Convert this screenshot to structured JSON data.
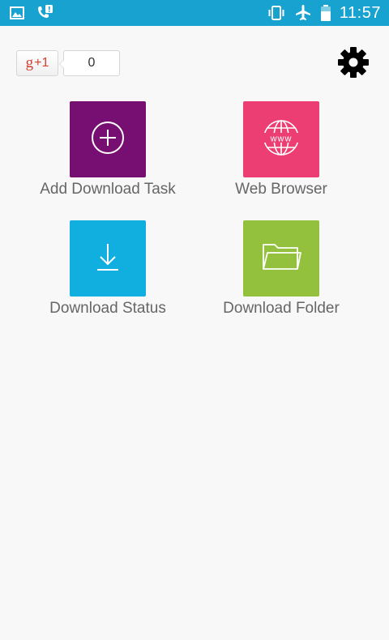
{
  "status_bar": {
    "time": "11:57",
    "color": "#17a2cf",
    "icons_left": [
      "image-icon",
      "phone-alert-icon"
    ],
    "icons_right": [
      "vibrate-icon",
      "airplane-icon",
      "battery-icon"
    ]
  },
  "gplus": {
    "g_label": "g",
    "plus_label": "+1",
    "count": "0"
  },
  "settings": {
    "icon": "gear-icon"
  },
  "tiles": [
    {
      "label": "Add Download Task",
      "color": "#770f72",
      "icon": "plus-circle-icon"
    },
    {
      "label": "Web Browser",
      "color": "#ec3e73",
      "icon": "globe-www-icon"
    },
    {
      "label": "Download Status",
      "color": "#10afe0",
      "icon": "download-arrow-icon"
    },
    {
      "label": "Download Folder",
      "color": "#93c13e",
      "icon": "folder-icon"
    }
  ]
}
